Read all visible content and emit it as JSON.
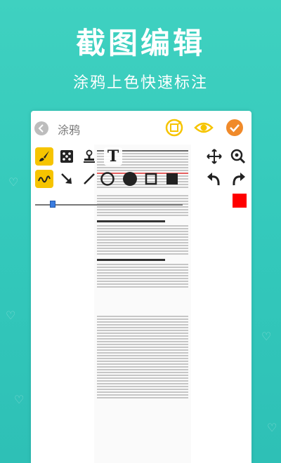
{
  "hero": {
    "title": "截图编辑",
    "subtitle": "涂鸦上色快速标注"
  },
  "toolbar": {
    "title": "涂鸦",
    "icons": [
      "back-icon",
      "rotate-icon",
      "eye-icon",
      "confirm-icon"
    ]
  },
  "tools": {
    "row1": [
      "brush-icon",
      "mosaic-icon",
      "stamp-icon",
      "text-icon"
    ],
    "row2": [
      "freehand-icon",
      "arrow-icon",
      "line-icon",
      "circle-outline-icon",
      "circle-fill-icon",
      "rect-outline-icon",
      "rect-fill-icon"
    ],
    "right_top": [
      "move-icon",
      "zoom-icon"
    ],
    "right_row2": [
      "undo-icon",
      "redo-icon"
    ],
    "text_tool_label": "T"
  },
  "colors": {
    "accent": "#33c8bb",
    "tool_selected": "#f6c400",
    "current_color": "#ff0000",
    "confirm": "#f08a2a"
  },
  "slider": {
    "level": 0.1
  }
}
